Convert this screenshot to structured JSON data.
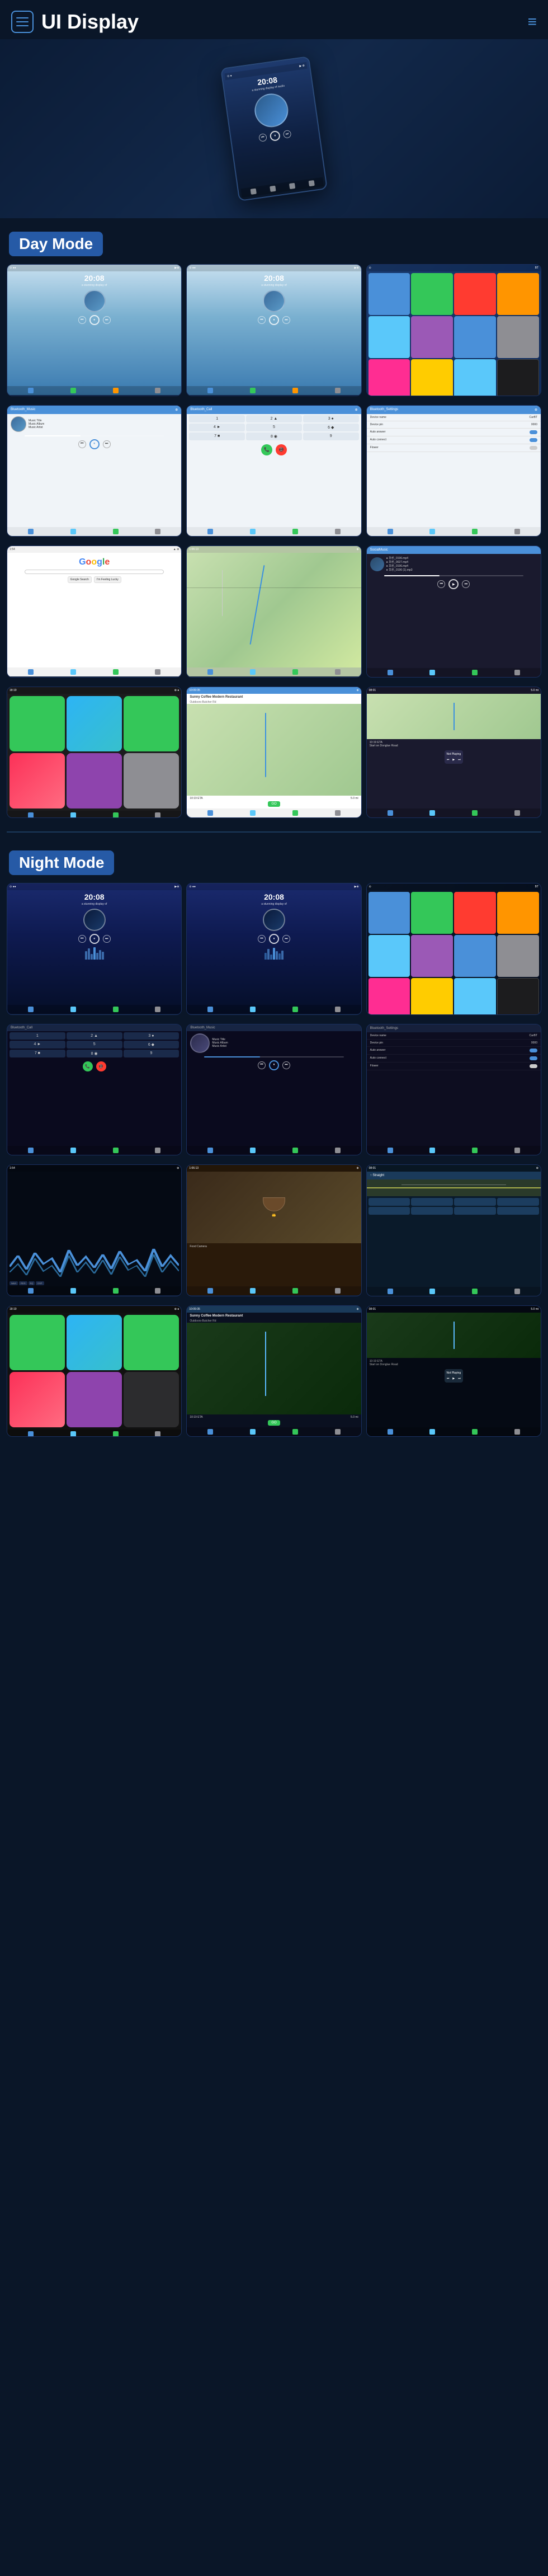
{
  "header": {
    "title": "UI Display",
    "menu_icon": "☰",
    "nav_icon": "≡"
  },
  "day_mode": {
    "label": "Day Mode"
  },
  "night_mode": {
    "label": "Night Mode"
  },
  "screens": {
    "music": {
      "time": "20:08",
      "subtitle": "a stunning display of audio",
      "title": "Music Title",
      "album": "Music Album",
      "artist": "Music Artist"
    },
    "bluetooth_call": {
      "title": "Bluetooth_Call"
    },
    "bluetooth_music": {
      "title": "Bluetooth_Music"
    },
    "bluetooth_settings": {
      "title": "Bluetooth_Settings",
      "device_name_label": "Device name",
      "device_name_value": "CarBT",
      "device_pin_label": "Device pin",
      "device_pin_value": "0000",
      "auto_answer_label": "Auto answer",
      "auto_connect_label": "Auto connect",
      "flower_label": "Flower"
    },
    "social_music": {
      "title": "SocialMusic"
    },
    "google": {
      "logo": "Google"
    },
    "nav": {
      "restaurant": "Sunny Coffee Modern Restaurant",
      "address": "Outdoors-Butcher Rd",
      "eta": "10:19 ETA",
      "distance": "5.0 mi",
      "go": "GO",
      "start": "Start on Donglue Road"
    }
  }
}
